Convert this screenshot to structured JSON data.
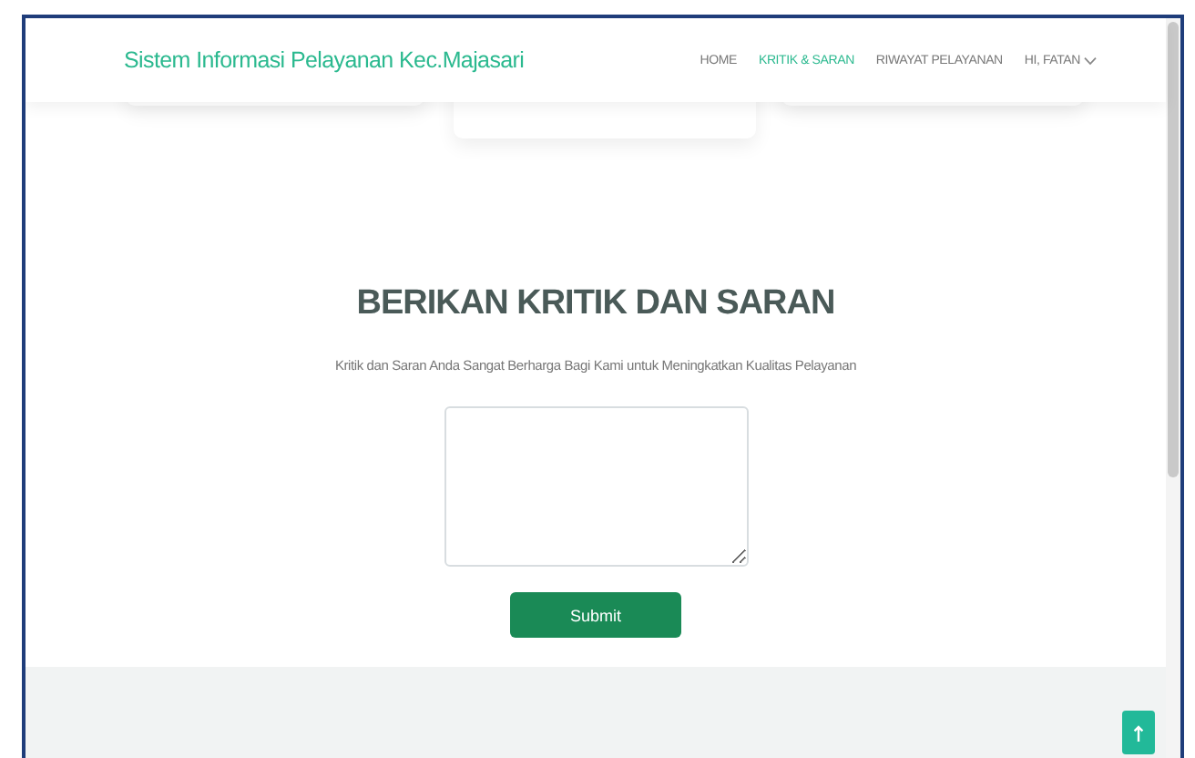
{
  "header": {
    "brand": "Sistem Informasi Pelayanan Kec.Majasari",
    "nav": [
      {
        "label": "HOME",
        "selected": false,
        "kind": "link"
      },
      {
        "label": "KRITIK & SARAN",
        "selected": true,
        "kind": "link"
      },
      {
        "label": "RIWAYAT PELAYANAN",
        "selected": false,
        "kind": "link"
      },
      {
        "label": "HI, FATAN",
        "selected": false,
        "kind": "dropdown"
      }
    ]
  },
  "feedback": {
    "title": "BERIKAN KRITIK DAN SARAN",
    "subtitle": "Kritik dan Saran Anda Sangat Berharga Bagi Kami untuk Meningkatkan Kualitas Pelayanan",
    "submit": "Submit"
  }
}
